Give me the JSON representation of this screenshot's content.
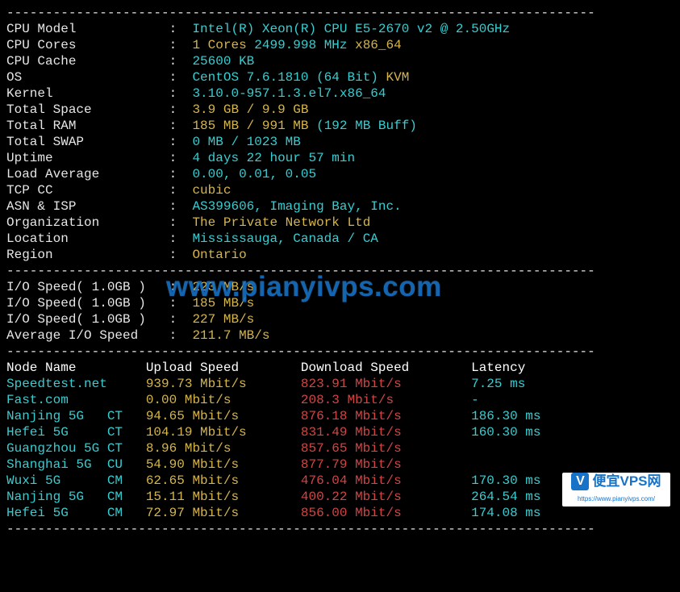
{
  "divider": "----------------------------------------------------------------------------",
  "sys": [
    {
      "label": "CPU Model          ",
      "segments": [
        {
          "cls": "cyan",
          "t": "Intel(R) Xeon(R) CPU E5-2670 v2 @ 2.50GHz"
        }
      ]
    },
    {
      "label": "CPU Cores          ",
      "segments": [
        {
          "cls": "yellow",
          "t": "1 Cores"
        },
        {
          "cls": "cyan",
          "t": " 2499.998 MHz "
        },
        {
          "cls": "yellow",
          "t": "x86_64"
        }
      ]
    },
    {
      "label": "CPU Cache          ",
      "segments": [
        {
          "cls": "cyan",
          "t": "25600 KB"
        }
      ]
    },
    {
      "label": "OS                 ",
      "segments": [
        {
          "cls": "cyan",
          "t": "CentOS 7.6.1810 (64 Bit) "
        },
        {
          "cls": "yellow",
          "t": "KVM"
        }
      ]
    },
    {
      "label": "Kernel             ",
      "segments": [
        {
          "cls": "cyan",
          "t": "3.10.0-957.1.3.el7.x86_64"
        }
      ]
    },
    {
      "label": "Total Space        ",
      "segments": [
        {
          "cls": "yellow",
          "t": "3.9 GB / 9.9 GB"
        }
      ]
    },
    {
      "label": "Total RAM          ",
      "segments": [
        {
          "cls": "yellow",
          "t": "185 MB / 991 MB"
        },
        {
          "cls": "cyan",
          "t": " (192 MB Buff)"
        }
      ]
    },
    {
      "label": "Total SWAP         ",
      "segments": [
        {
          "cls": "cyan",
          "t": "0 MB / 1023 MB"
        }
      ]
    },
    {
      "label": "Uptime             ",
      "segments": [
        {
          "cls": "cyan",
          "t": "4 days 22 hour 57 min"
        }
      ]
    },
    {
      "label": "Load Average       ",
      "segments": [
        {
          "cls": "cyan",
          "t": "0.00, 0.01, 0.05"
        }
      ]
    },
    {
      "label": "TCP CC             ",
      "segments": [
        {
          "cls": "yellow",
          "t": "cubic"
        }
      ]
    },
    {
      "label": "ASN & ISP          ",
      "segments": [
        {
          "cls": "cyan",
          "t": "AS399606, Imaging Bay, Inc."
        }
      ]
    },
    {
      "label": "Organization       ",
      "segments": [
        {
          "cls": "yellow",
          "t": "The Private Network Ltd"
        }
      ]
    },
    {
      "label": "Location           ",
      "segments": [
        {
          "cls": "cyan",
          "t": "Mississauga, Canada / CA"
        }
      ]
    },
    {
      "label": "Region             ",
      "segments": [
        {
          "cls": "yellow",
          "t": "Ontario"
        }
      ]
    }
  ],
  "io": [
    {
      "label": "I/O Speed( 1.0GB ) ",
      "value": "223 MB/s"
    },
    {
      "label": "I/O Speed( 1.0GB ) ",
      "value": "185 MB/s"
    },
    {
      "label": "I/O Speed( 1.0GB ) ",
      "value": "227 MB/s"
    },
    {
      "label": "Average I/O Speed  ",
      "value": "211.7 MB/s"
    }
  ],
  "speedHeader": {
    "node": "Node Name",
    "up": "Upload Speed",
    "down": "Download Speed",
    "lat": "Latency"
  },
  "speed": [
    {
      "node": "Speedtest.net    ",
      "up": "939.73 Mbit/s    ",
      "down": "823.91 Mbit/s     ",
      "lat": "7.25 ms"
    },
    {
      "node": "Fast.com         ",
      "up": "0.00 Mbit/s      ",
      "down": "208.3 Mbit/s      ",
      "lat": "-"
    },
    {
      "node": "Nanjing 5G   CT  ",
      "up": "94.65 Mbit/s     ",
      "down": "876.18 Mbit/s     ",
      "lat": "186.30 ms"
    },
    {
      "node": "Hefei 5G     CT  ",
      "up": "104.19 Mbit/s    ",
      "down": "831.49 Mbit/s     ",
      "lat": "160.30 ms"
    },
    {
      "node": "Guangzhou 5G CT  ",
      "up": "8.96 Mbit/s      ",
      "down": "857.65 Mbit/s     ",
      "lat": ""
    },
    {
      "node": "Shanghai 5G  CU  ",
      "up": "54.90 Mbit/s     ",
      "down": "877.79 Mbit/s     ",
      "lat": ""
    },
    {
      "node": "Wuxi 5G      CM  ",
      "up": "62.65 Mbit/s     ",
      "down": "476.04 Mbit/s     ",
      "lat": "170.30 ms"
    },
    {
      "node": "Nanjing 5G   CM  ",
      "up": "15.11 Mbit/s     ",
      "down": "400.22 Mbit/s     ",
      "lat": "264.54 ms"
    },
    {
      "node": "Hefei 5G     CM  ",
      "up": "72.97 Mbit/s     ",
      "down": "856.00 Mbit/s     ",
      "lat": "174.08 ms"
    }
  ],
  "watermark": "www.pianyivps.com",
  "logo": {
    "v": "V",
    "cn": "便宜VPS网",
    "url": "https://www.pianyivps.com/"
  }
}
